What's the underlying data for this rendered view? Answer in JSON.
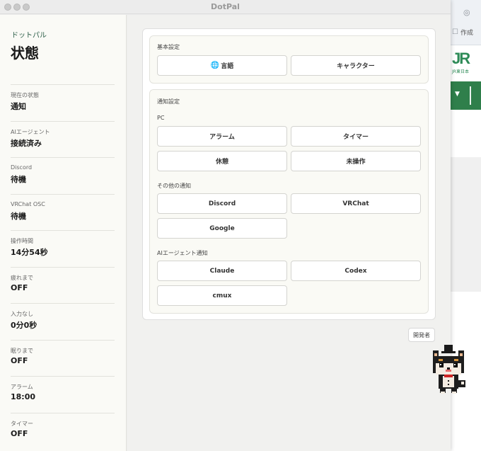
{
  "window": {
    "title": "DotPal"
  },
  "sidebar": {
    "app_name": "ドットパル",
    "page_title": "状態",
    "items": [
      {
        "label": "現在の状態",
        "value": "通知"
      },
      {
        "label": "AIエージェント",
        "value": "接続済み"
      },
      {
        "label": "Discord",
        "value": "待機"
      },
      {
        "label": "VRChat OSC",
        "value": "待機"
      },
      {
        "label": "操作時間",
        "value": "14分54秒"
      },
      {
        "label": "疲れまで",
        "value": "OFF"
      },
      {
        "label": "入力なし",
        "value": "0分0秒"
      },
      {
        "label": "眠りまで",
        "value": "OFF"
      },
      {
        "label": "アラーム",
        "value": "18:00"
      },
      {
        "label": "タイマー",
        "value": "OFF"
      }
    ]
  },
  "basic_settings": {
    "title": "基本設定",
    "language_label": "言語",
    "language_icon": "globe-icon",
    "character_label": "キャラクター"
  },
  "notification_settings": {
    "title": "通知設定",
    "pc": {
      "title": "PC",
      "alarm": "アラーム",
      "timer": "タイマー",
      "rest": "休憩",
      "idle": "未操作"
    },
    "other": {
      "title": "その他の通知",
      "discord": "Discord",
      "vrchat": "VRChat",
      "google": "Google"
    },
    "ai_agent": {
      "title": "AIエージェント通知",
      "claude": "Claude",
      "codex": "Codex",
      "cmux": "cmux"
    }
  },
  "developer_button": "開発者",
  "background_app": {
    "create_label": "作成",
    "logo_text": "JR",
    "logo_sub": "JR東日本"
  },
  "colors": {
    "accent": "#2d5f49",
    "background_green": "#2f7f4b"
  }
}
